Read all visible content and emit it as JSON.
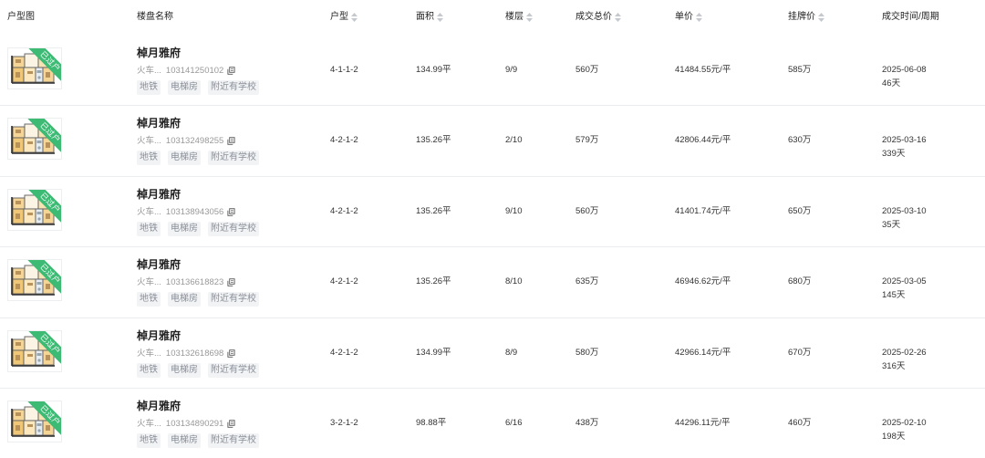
{
  "icons": {
    "sort": "sort-icon",
    "copy": "copy-icon",
    "thumbnail": "floor-plan-image"
  },
  "colors": {
    "ribbon": "#3dba74",
    "tag_bg": "#f2f3f5",
    "tag_text": "#8a8f99",
    "divider": "#ebedf0",
    "muted": "#999999"
  },
  "table": {
    "headers": {
      "floor_plan": "户型图",
      "name": "楼盘名称",
      "layout": "户型",
      "area": "面积",
      "floor": "楼层",
      "total_price": "成交总价",
      "unit_price": "单价",
      "listing_price": "挂牌价",
      "deal_time": "成交时间/周期"
    },
    "rows": [
      {
        "badge": "已过户",
        "name": "棹月雅府",
        "location": "火车...",
        "listing_id": "103141250102",
        "tags": [
          "地铁",
          "电梯房",
          "附近有学校"
        ],
        "layout": "4-1-1-2",
        "area": "134.99平",
        "floor": "9/9",
        "total_price": "560万",
        "unit_price": "41484.55元/平",
        "listing_price": "585万",
        "deal_date": "2025-06-08",
        "cycle": "46天"
      },
      {
        "badge": "已过户",
        "name": "棹月雅府",
        "location": "火车...",
        "listing_id": "103132498255",
        "tags": [
          "地铁",
          "电梯房",
          "附近有学校"
        ],
        "layout": "4-2-1-2",
        "area": "135.26平",
        "floor": "2/10",
        "total_price": "579万",
        "unit_price": "42806.44元/平",
        "listing_price": "630万",
        "deal_date": "2025-03-16",
        "cycle": "339天"
      },
      {
        "badge": "已过户",
        "name": "棹月雅府",
        "location": "火车...",
        "listing_id": "103138943056",
        "tags": [
          "地铁",
          "电梯房",
          "附近有学校"
        ],
        "layout": "4-2-1-2",
        "area": "135.26平",
        "floor": "9/10",
        "total_price": "560万",
        "unit_price": "41401.74元/平",
        "listing_price": "650万",
        "deal_date": "2025-03-10",
        "cycle": "35天"
      },
      {
        "badge": "已过户",
        "name": "棹月雅府",
        "location": "火车...",
        "listing_id": "103136618823",
        "tags": [
          "地铁",
          "电梯房",
          "附近有学校"
        ],
        "layout": "4-2-1-2",
        "area": "135.26平",
        "floor": "8/10",
        "total_price": "635万",
        "unit_price": "46946.62元/平",
        "listing_price": "680万",
        "deal_date": "2025-03-05",
        "cycle": "145天"
      },
      {
        "badge": "已过户",
        "name": "棹月雅府",
        "location": "火车...",
        "listing_id": "103132618698",
        "tags": [
          "地铁",
          "电梯房",
          "附近有学校"
        ],
        "layout": "4-2-1-2",
        "area": "134.99平",
        "floor": "8/9",
        "total_price": "580万",
        "unit_price": "42966.14元/平",
        "listing_price": "670万",
        "deal_date": "2025-02-26",
        "cycle": "316天"
      },
      {
        "badge": "已过户",
        "name": "棹月雅府",
        "location": "火车...",
        "listing_id": "103134890291",
        "tags": [
          "地铁",
          "电梯房",
          "附近有学校"
        ],
        "layout": "3-2-1-2",
        "area": "98.88平",
        "floor": "6/16",
        "total_price": "438万",
        "unit_price": "44296.11元/平",
        "listing_price": "460万",
        "deal_date": "2025-02-10",
        "cycle": "198天"
      }
    ]
  }
}
